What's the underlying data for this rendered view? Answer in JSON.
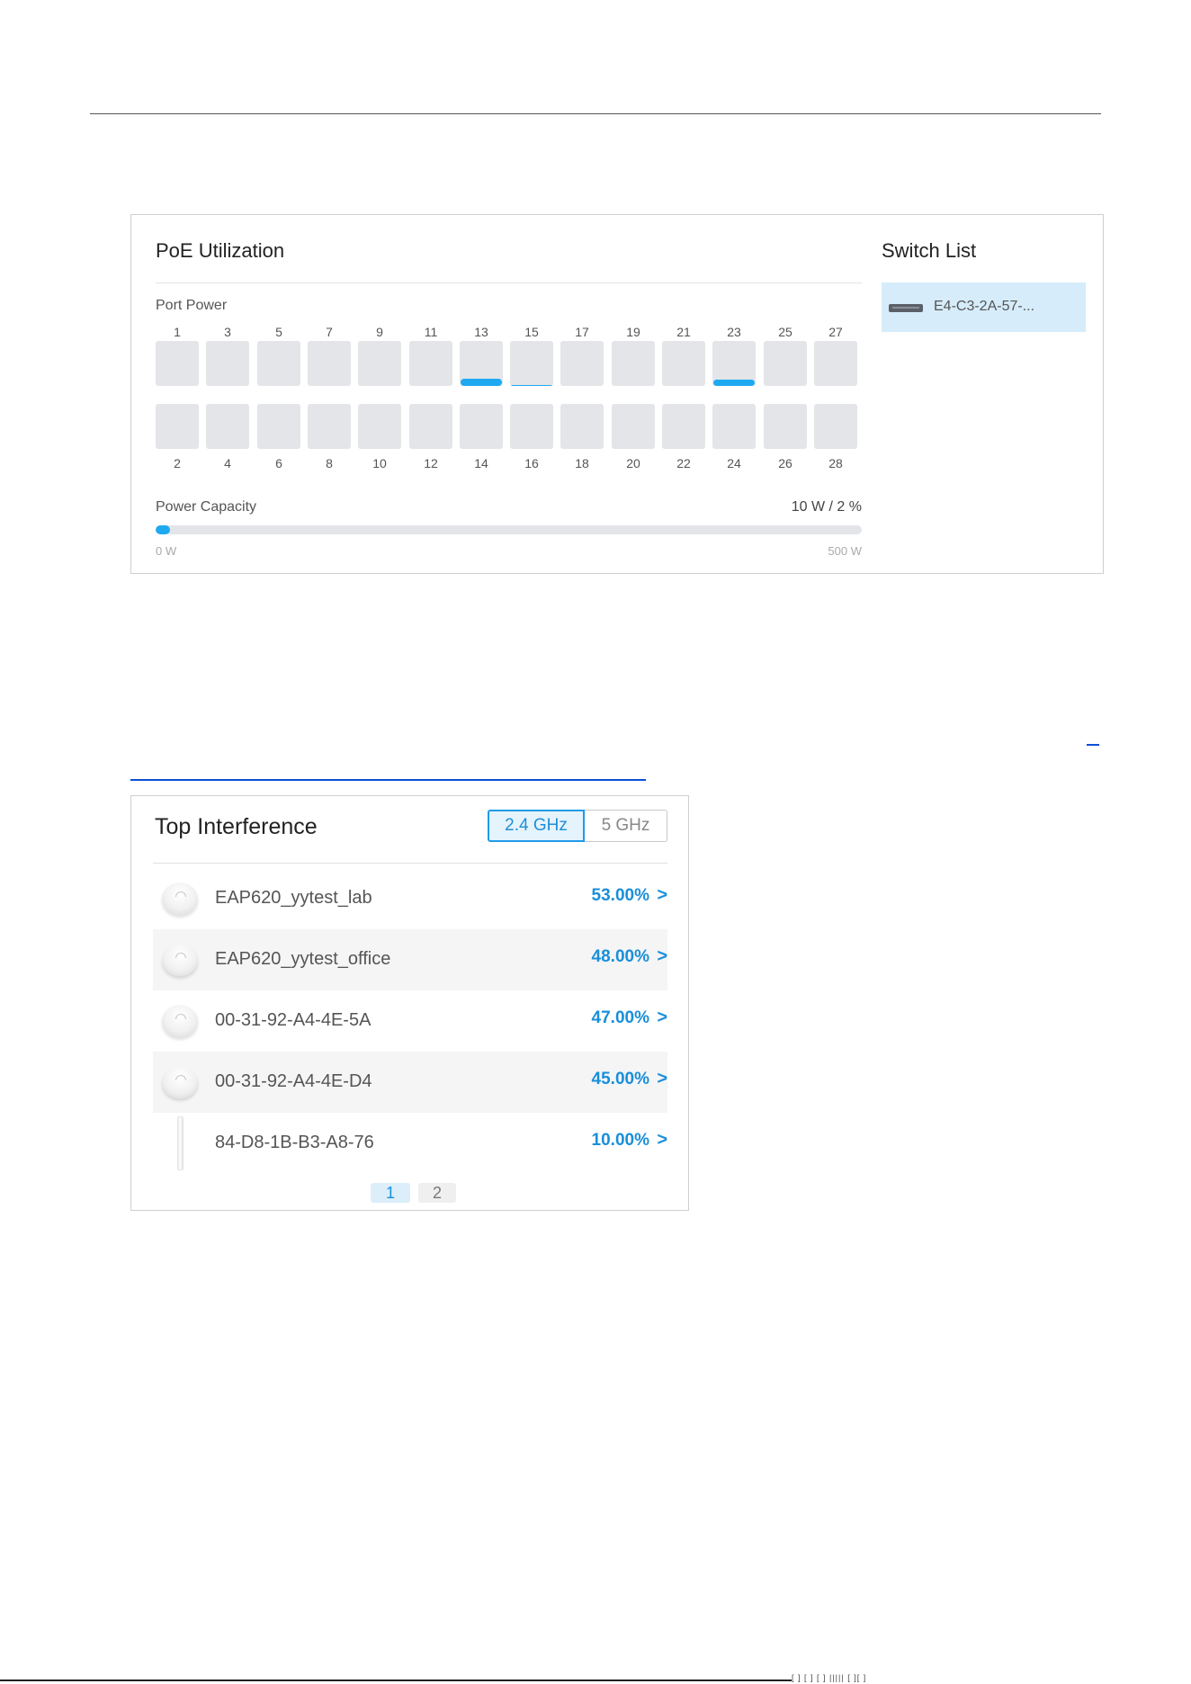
{
  "poe": {
    "title": "PoE Utilization",
    "port_power_label": "Port Power",
    "ports": [
      {
        "num": "1",
        "fill": 0
      },
      {
        "num": "2",
        "fill": 0
      },
      {
        "num": "3",
        "fill": 0
      },
      {
        "num": "4",
        "fill": 0
      },
      {
        "num": "5",
        "fill": 0
      },
      {
        "num": "6",
        "fill": 0
      },
      {
        "num": "7",
        "fill": 0
      },
      {
        "num": "8",
        "fill": 0
      },
      {
        "num": "9",
        "fill": 0
      },
      {
        "num": "10",
        "fill": 0
      },
      {
        "num": "11",
        "fill": 0
      },
      {
        "num": "12",
        "fill": 0
      },
      {
        "num": "13",
        "fill": 0.16
      },
      {
        "num": "14",
        "fill": 0
      },
      {
        "num": "15",
        "fill": 0.02
      },
      {
        "num": "16",
        "fill": 0
      },
      {
        "num": "17",
        "fill": 0
      },
      {
        "num": "18",
        "fill": 0
      },
      {
        "num": "19",
        "fill": 0
      },
      {
        "num": "20",
        "fill": 0
      },
      {
        "num": "21",
        "fill": 0
      },
      {
        "num": "22",
        "fill": 0
      },
      {
        "num": "23",
        "fill": 0.14
      },
      {
        "num": "24",
        "fill": 0
      },
      {
        "num": "25",
        "fill": 0
      },
      {
        "num": "26",
        "fill": 0
      },
      {
        "num": "27",
        "fill": 0
      },
      {
        "num": "28",
        "fill": 0
      }
    ],
    "capacity_label": "Power Capacity",
    "capacity_value": "10 W / 2 %",
    "capacity_percent": 2,
    "capacity_min": "0 W",
    "capacity_max": "500 W",
    "accent_color": "#1eaaf1"
  },
  "switch_list": {
    "title": "Switch List",
    "items": [
      {
        "name": "E4-C3-2A-57-..."
      }
    ]
  },
  "interference": {
    "title": "Top Interference",
    "bands": [
      {
        "label": "2.4 GHz",
        "active": true
      },
      {
        "label": "5 GHz",
        "active": false
      }
    ],
    "rows": [
      {
        "name": "EAP620_yytest_lab",
        "value": "53.00%",
        "icon": "ceiling-ap-icon"
      },
      {
        "name": "EAP620_yytest_office",
        "value": "48.00%",
        "icon": "ceiling-ap-icon"
      },
      {
        "name": "00-31-92-A4-4E-5A",
        "value": "47.00%",
        "icon": "ceiling-ap-icon"
      },
      {
        "name": "00-31-92-A4-4E-D4",
        "value": "45.00%",
        "icon": "ceiling-ap-icon"
      },
      {
        "name": "84-D8-1B-B3-A8-76",
        "value": "10.00%",
        "icon": "outdoor-ap-icon"
      }
    ],
    "chevron": ">",
    "pages": [
      "1",
      "2"
    ],
    "current_page": "1"
  },
  "footer": {
    "glyphs": "[ ] [ ] [ ] ||||| [ ][ ]"
  }
}
